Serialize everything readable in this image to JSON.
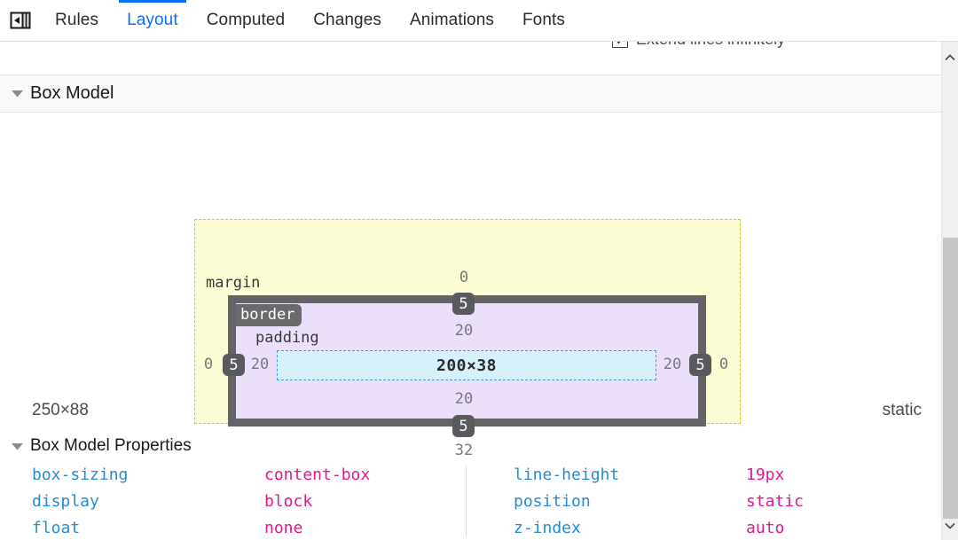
{
  "toolbar": {
    "panel_toggle_icon": "toggle-sidebar-icon",
    "tabs": [
      {
        "label": "Rules",
        "active": false
      },
      {
        "label": "Layout",
        "active": true
      },
      {
        "label": "Computed",
        "active": false
      },
      {
        "label": "Changes",
        "active": false
      },
      {
        "label": "Animations",
        "active": false
      },
      {
        "label": "Fonts",
        "active": false
      }
    ],
    "active_tab_color": "#0a6cff"
  },
  "grid_settings": {
    "extend_lines_label": "Extend lines infinitely",
    "extend_lines_checked": true
  },
  "box_model_section": {
    "title": "Box Model",
    "expanded": true,
    "diagram": {
      "region_labels": {
        "margin": "margin",
        "border": "border",
        "padding": "padding"
      },
      "content_dimensions": "200×38",
      "margin": {
        "top": "0",
        "right": "0",
        "bottom": "32",
        "left": "0"
      },
      "border": {
        "top": "5",
        "right": "5",
        "bottom": "5",
        "left": "5"
      },
      "padding": {
        "top": "20",
        "right": "20",
        "bottom": "20",
        "left": "20"
      },
      "colors": {
        "margin_fill": "#fdfdd5",
        "margin_stroke": "#cdcd29",
        "border_fill": "#646468",
        "padding_fill": "#ebdffa",
        "content_fill": "#d7f1fb",
        "content_stroke": "#3c9ede",
        "badge_fill": "#585a5d"
      }
    },
    "summary": {
      "size": "250×88",
      "position": "static"
    }
  },
  "box_model_properties": {
    "title": "Box Model Properties",
    "expanded": true,
    "left_column": [
      {
        "name": "box-sizing",
        "value": "content-box"
      },
      {
        "name": "display",
        "value": "block"
      },
      {
        "name": "float",
        "value": "none"
      }
    ],
    "right_column": [
      {
        "name": "line-height",
        "value": "19px"
      },
      {
        "name": "position",
        "value": "static"
      },
      {
        "name": "z-index",
        "value": "auto"
      }
    ],
    "name_color": "#268bd2",
    "value_color": "#e0198f"
  },
  "scrollbar": {
    "up_arrow_icon": "chevron-up-icon",
    "down_arrow_icon": "chevron-down-icon"
  }
}
